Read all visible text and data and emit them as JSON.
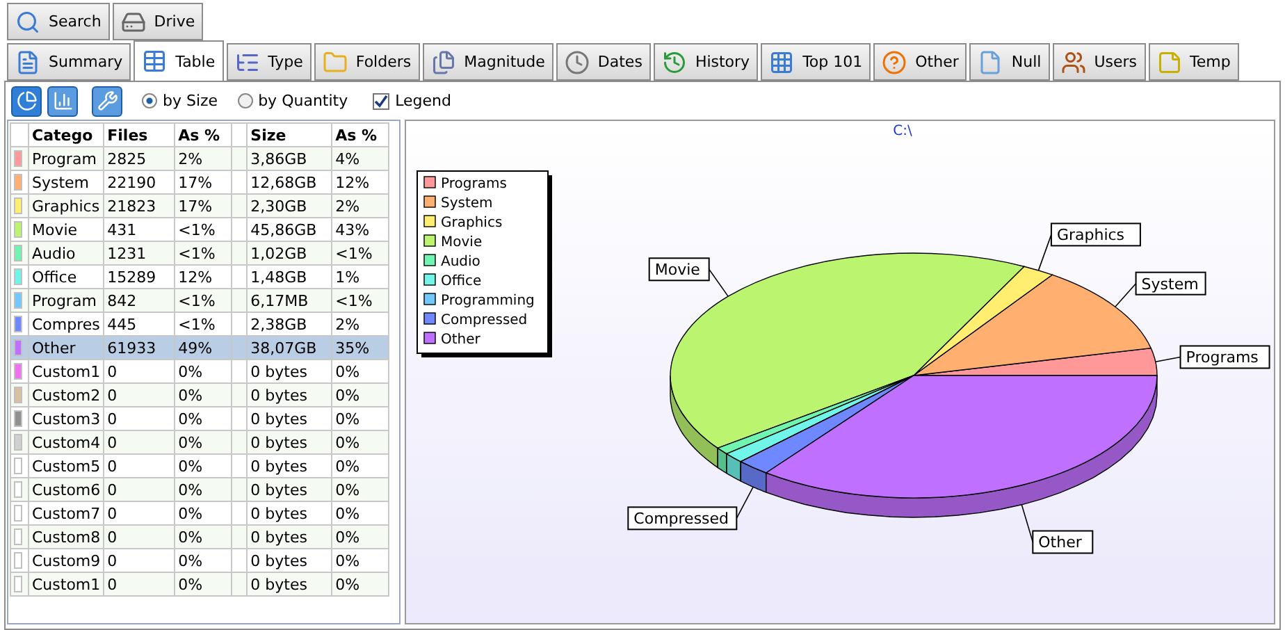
{
  "top_tabs": [
    {
      "label": "Search",
      "selected": false
    },
    {
      "label": "Drive",
      "selected": false
    }
  ],
  "tabs": [
    {
      "label": "Summary",
      "selected": false
    },
    {
      "label": "Table",
      "selected": true
    },
    {
      "label": "Type",
      "selected": false
    },
    {
      "label": "Folders",
      "selected": false
    },
    {
      "label": "Magnitude",
      "selected": false
    },
    {
      "label": "Dates",
      "selected": false
    },
    {
      "label": "History",
      "selected": false
    },
    {
      "label": "Top 101",
      "selected": false
    },
    {
      "label": "Other",
      "selected": false
    },
    {
      "label": "Null",
      "selected": false
    },
    {
      "label": "Users",
      "selected": false
    },
    {
      "label": "Temp",
      "selected": false
    }
  ],
  "toolbar": {
    "view_buttons": [
      {
        "kind": "pie",
        "selected": true
      },
      {
        "kind": "bar",
        "selected": false
      },
      {
        "kind": "settings",
        "selected": false
      }
    ],
    "radios": [
      {
        "label": "by Size",
        "selected": true
      },
      {
        "label": "by Quantity",
        "selected": false
      }
    ],
    "legend_checkbox": {
      "label": "Legend",
      "checked": true
    }
  },
  "table": {
    "columns": [
      "Catego",
      "Files",
      "As %",
      "",
      "Size",
      "As %"
    ],
    "rows": [
      {
        "color": "#ff9999",
        "cells": [
          "Program",
          "2825",
          "2%",
          "",
          "3,86GB",
          "4%"
        ],
        "selected": false
      },
      {
        "color": "#ffb070",
        "cells": [
          "System",
          "22190",
          "17%",
          "",
          "12,68GB",
          "12%"
        ],
        "selected": false
      },
      {
        "color": "#ffee70",
        "cells": [
          "Graphics",
          "21823",
          "17%",
          "",
          "2,30GB",
          "2%"
        ],
        "selected": false
      },
      {
        "color": "#bbf570",
        "cells": [
          "Movie",
          "431",
          "<1%",
          "",
          "45,86GB",
          "43%"
        ],
        "selected": false
      },
      {
        "color": "#70f5b0",
        "cells": [
          "Audio",
          "1231",
          "<1%",
          "",
          "1,02GB",
          "<1%"
        ],
        "selected": false
      },
      {
        "color": "#70f5e8",
        "cells": [
          "Office",
          "15289",
          "12%",
          "",
          "1,48GB",
          "1%"
        ],
        "selected": false
      },
      {
        "color": "#70c8ff",
        "cells": [
          "Program",
          "842",
          "<1%",
          "",
          "6,17MB",
          "<1%"
        ],
        "selected": false
      },
      {
        "color": "#7088ff",
        "cells": [
          "Compres",
          "445",
          "<1%",
          "",
          "2,38GB",
          "2%"
        ],
        "selected": false
      },
      {
        "color": "#c070ff",
        "cells": [
          "Other",
          "61933",
          "49%",
          "",
          "38,07GB",
          "35%"
        ],
        "selected": true
      },
      {
        "color": "#f070f0",
        "cells": [
          "Custom1",
          "0",
          "0%",
          "",
          "0 bytes",
          "0%"
        ],
        "selected": false
      },
      {
        "color": "#d8c0a0",
        "cells": [
          "Custom2",
          "0",
          "0%",
          "",
          "0 bytes",
          "0%"
        ],
        "selected": false
      },
      {
        "color": "#909090",
        "cells": [
          "Custom3",
          "0",
          "0%",
          "",
          "0 bytes",
          "0%"
        ],
        "selected": false
      },
      {
        "color": "#d0d0d0",
        "cells": [
          "Custom4",
          "0",
          "0%",
          "",
          "0 bytes",
          "0%"
        ],
        "selected": false
      },
      {
        "color": "#ffffff",
        "cells": [
          "Custom5",
          "0",
          "0%",
          "",
          "0 bytes",
          "0%"
        ],
        "selected": false
      },
      {
        "color": "#ffffff",
        "cells": [
          "Custom6",
          "0",
          "0%",
          "",
          "0 bytes",
          "0%"
        ],
        "selected": false
      },
      {
        "color": "#ffffff",
        "cells": [
          "Custom7",
          "0",
          "0%",
          "",
          "0 bytes",
          "0%"
        ],
        "selected": false
      },
      {
        "color": "#ffffff",
        "cells": [
          "Custom8",
          "0",
          "0%",
          "",
          "0 bytes",
          "0%"
        ],
        "selected": false
      },
      {
        "color": "#ffffff",
        "cells": [
          "Custom9",
          "0",
          "0%",
          "",
          "0 bytes",
          "0%"
        ],
        "selected": false
      },
      {
        "color": "#ffffff",
        "cells": [
          "Custom1",
          "0",
          "0%",
          "",
          "0 bytes",
          "0%"
        ],
        "selected": false
      }
    ]
  },
  "chart": {
    "title": "C:\\",
    "legend": [
      {
        "label": "Programs",
        "color": "#ff9999"
      },
      {
        "label": "System",
        "color": "#ffb070"
      },
      {
        "label": "Graphics",
        "color": "#ffee70"
      },
      {
        "label": "Movie",
        "color": "#bbf570"
      },
      {
        "label": "Audio",
        "color": "#70f5b0"
      },
      {
        "label": "Office",
        "color": "#70f5e8"
      },
      {
        "label": "Programming",
        "color": "#70c8ff"
      },
      {
        "label": "Compressed",
        "color": "#7088ff"
      },
      {
        "label": "Other",
        "color": "#c070ff"
      }
    ],
    "slice_labels": [
      "Programs",
      "System",
      "Graphics",
      "Movie",
      "Compressed",
      "Other"
    ]
  }
}
